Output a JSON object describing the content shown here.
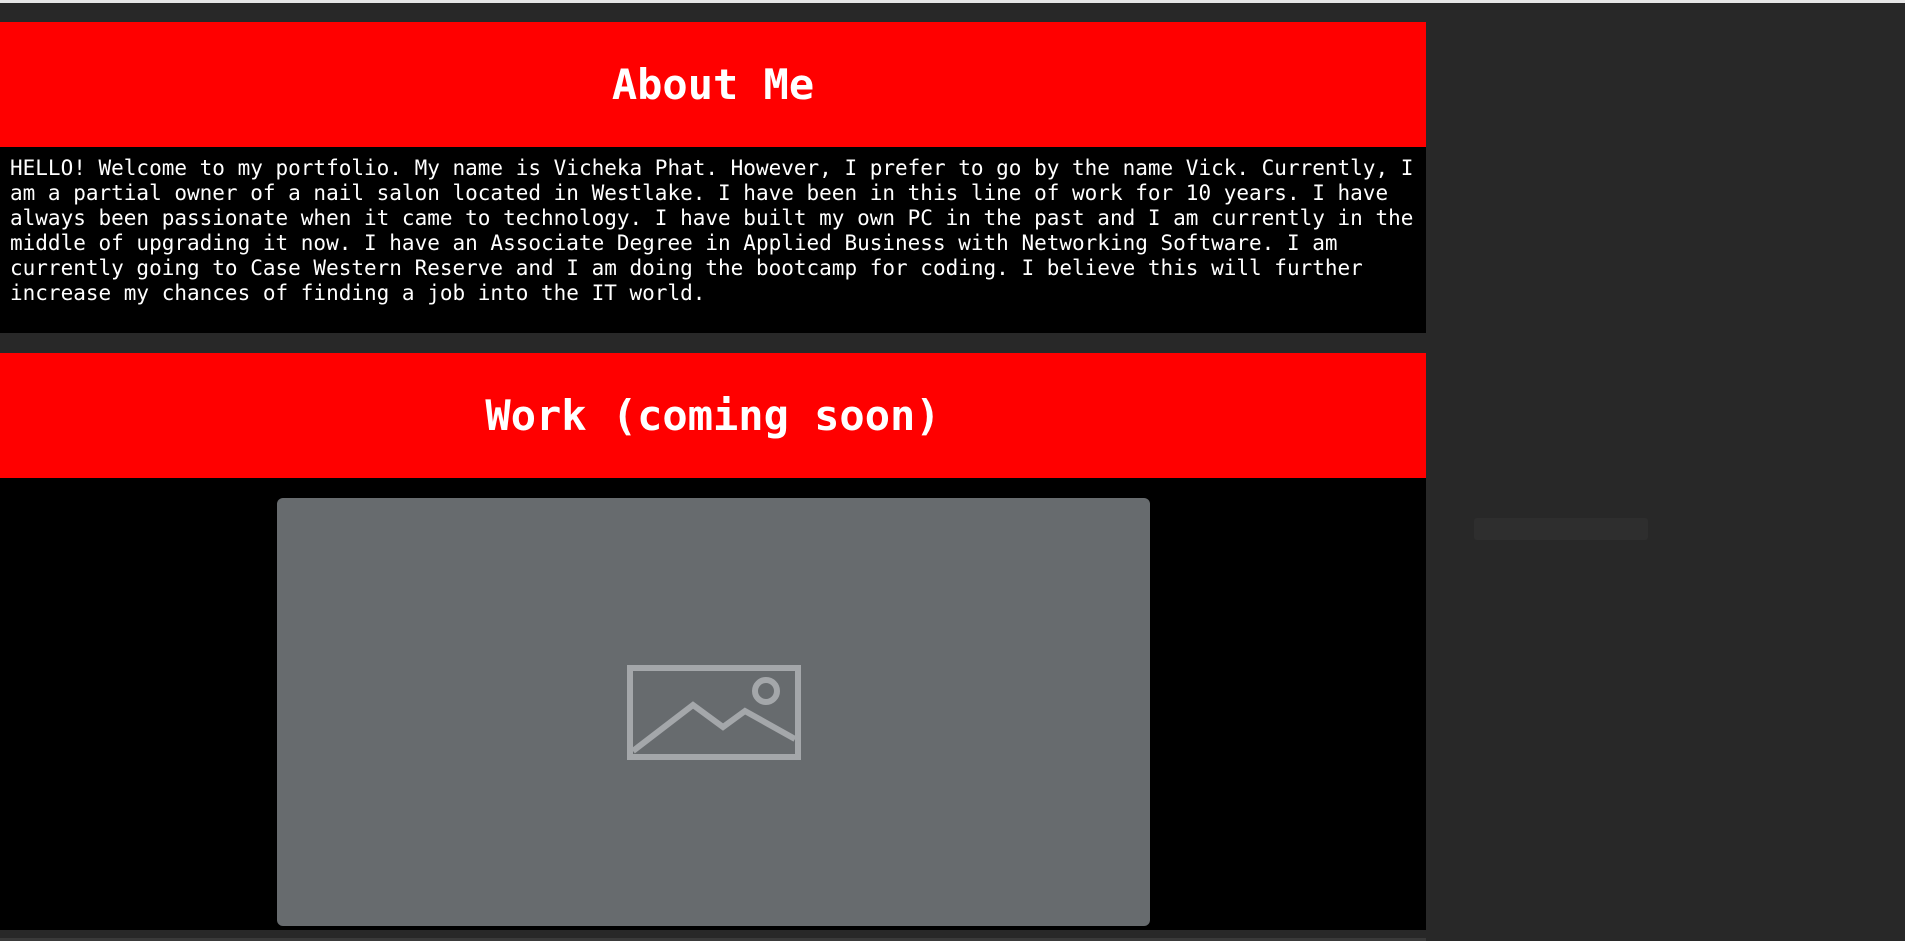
{
  "about": {
    "heading": "About Me",
    "body": "HELLO! Welcome to my portfolio. My name is Vicheka Phat. However, I prefer to go by the name Vick. Currently, I am a partial owner of a nail salon located in Westlake. I have been in this line of work for 10 years. I have always been passionate when it came to technology. I have built my own PC in the past and I am currently in the middle of upgrading it now. I have an Associate Degree in Applied Business with Networking Software. I am currently going to Case Western Reserve and I am doing the bootcamp for coding. I believe this will further increase my chances of finding a job into the IT world."
  },
  "work": {
    "heading": "Work (coming soon)",
    "image_icon": "image-placeholder-icon"
  },
  "colors": {
    "banner": "#ff0000",
    "section_bg": "#000000",
    "page_bg": "#282828",
    "placeholder_bg": "#676b6e",
    "text": "#ffffff"
  }
}
